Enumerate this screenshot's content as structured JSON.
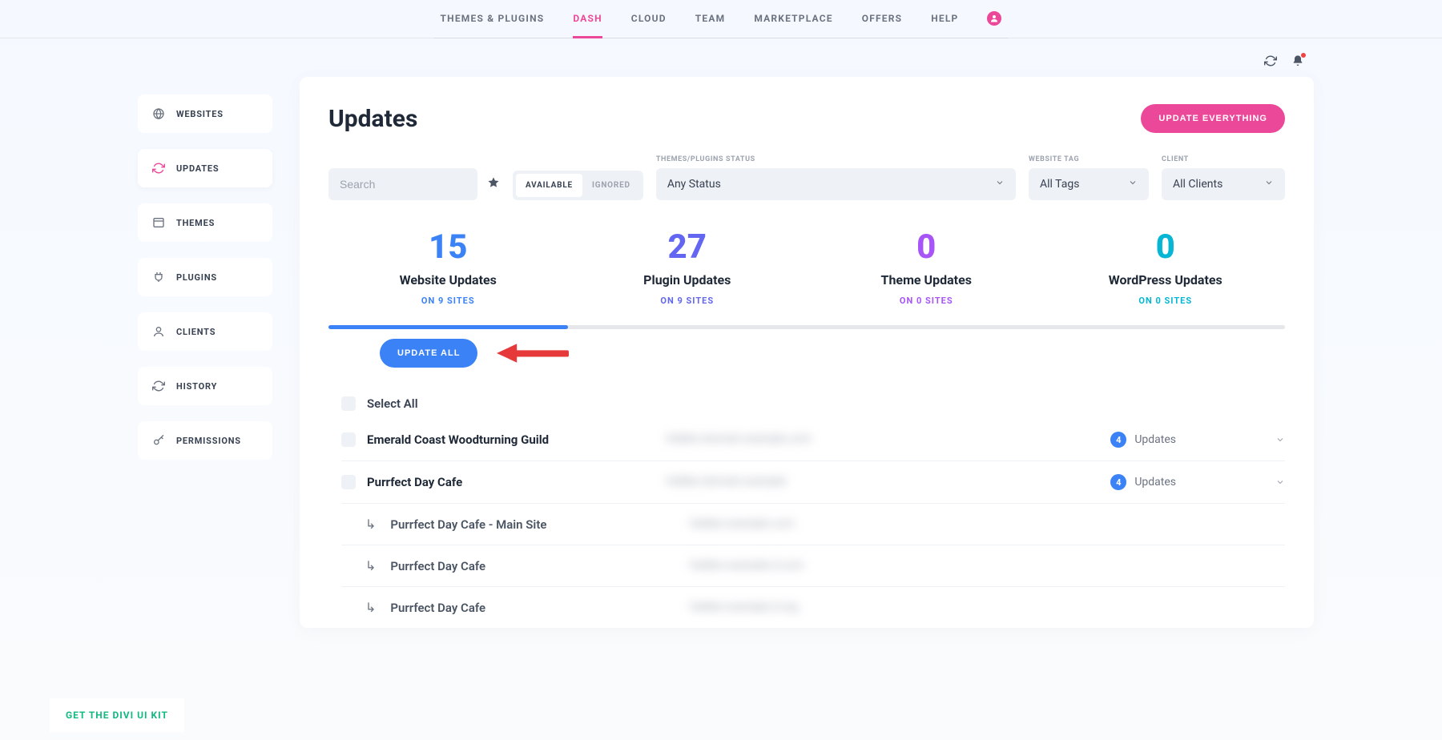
{
  "top_nav": {
    "items": [
      {
        "label": "THEMES & PLUGINS"
      },
      {
        "label": "DASH",
        "active": true
      },
      {
        "label": "CLOUD"
      },
      {
        "label": "TEAM"
      },
      {
        "label": "MARKETPLACE"
      },
      {
        "label": "OFFERS"
      },
      {
        "label": "HELP"
      }
    ]
  },
  "sidebar": {
    "items": [
      {
        "label": "WEBSITES",
        "icon": "globe-icon"
      },
      {
        "label": "UPDATES",
        "icon": "refresh-icon",
        "active": true
      },
      {
        "label": "THEMES",
        "icon": "layout-icon"
      },
      {
        "label": "PLUGINS",
        "icon": "plug-icon"
      },
      {
        "label": "CLIENTS",
        "icon": "user-icon"
      },
      {
        "label": "HISTORY",
        "icon": "refresh-icon"
      },
      {
        "label": "PERMISSIONS",
        "icon": "key-icon"
      }
    ]
  },
  "page": {
    "title": "Updates",
    "update_everything": "UPDATE EVERYTHING",
    "update_all": "UPDATE ALL",
    "select_all": "Select All"
  },
  "filters": {
    "search_placeholder": "Search",
    "toggle_available": "AVAILABLE",
    "toggle_ignored": "IGNORED",
    "status_label": "THEMES/PLUGINS STATUS",
    "status_value": "Any Status",
    "tag_label": "WEBSITE TAG",
    "tag_value": "All Tags",
    "client_label": "CLIENT",
    "client_value": "All Clients"
  },
  "stats": [
    {
      "num": "15",
      "label": "Website Updates",
      "sub": "ON 9 SITES",
      "color": "c-blue"
    },
    {
      "num": "27",
      "label": "Plugin Updates",
      "sub": "ON 9 SITES",
      "color": "c-indigo"
    },
    {
      "num": "0",
      "label": "Theme Updates",
      "sub": "ON 0 SITES",
      "color": "c-purple"
    },
    {
      "num": "0",
      "label": "WordPress Updates",
      "sub": "ON 0 SITES",
      "color": "c-cyan"
    }
  ],
  "progress_percent": 25,
  "list": {
    "rows": [
      {
        "name": "Emerald Coast Woodturning Guild",
        "url_redacted": "hidden-domain.example.com",
        "count": "4",
        "count_label": "Updates"
      },
      {
        "name": "Purrfect Day Cafe",
        "url_redacted": "hidden-domain.example",
        "count": "4",
        "count_label": "Updates"
      }
    ],
    "sub_rows": [
      {
        "name": "Purrfect Day Cafe - Main Site",
        "url_redacted": "hidden.example.com"
      },
      {
        "name": "Purrfect Day Cafe",
        "url_redacted": "hidden.example.d.com"
      },
      {
        "name": "Purrfect Day Cafe",
        "url_redacted": "hidden.example.d.org"
      }
    ]
  },
  "footer": {
    "link": "GET THE DIVI UI KIT"
  }
}
